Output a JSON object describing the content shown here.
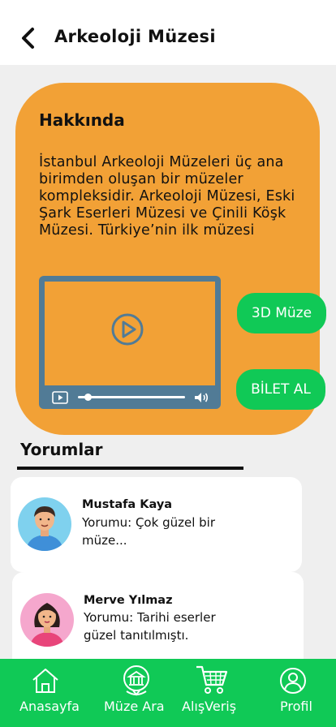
{
  "header": {
    "title": "Arkeoloji Müzesi",
    "back_icon": "chevron-left-icon"
  },
  "about": {
    "title": "Hakkında",
    "text": "İstanbul Arkeoloji Müzeleri üç ana birimden oluşan bir müzeler kompleksidir. Arkeoloji Müzesi, Eski Şark Eserleri Müzesi ve Çinili Köşk Müzesi. Türkiye’nin ilk müzesi",
    "card_color": "#f2a136",
    "video": {
      "progress": 0.1,
      "frame_color": "#517b96"
    }
  },
  "actions": {
    "button_3d": "3D Müze",
    "button_ticket": "BİLET AL",
    "accent_color": "#10c956"
  },
  "reviews": {
    "title": "Yorumlar",
    "items": [
      {
        "name": "Mustafa Kaya",
        "comment": "Yorumu: Çok güzel bir müze..."
      },
      {
        "name": "Merve Yılmaz",
        "comment": "Yorumu: Tarihi eserler güzel tanıtılmıştı."
      }
    ]
  },
  "nav": {
    "items": [
      {
        "label": "Anasayfa",
        "icon": "home-icon"
      },
      {
        "label": "Müze Ara",
        "icon": "museum-location-icon"
      },
      {
        "label": "AlışVeriş",
        "icon": "shopping-cart-icon"
      },
      {
        "label": "Profil",
        "icon": "user-icon"
      }
    ]
  }
}
